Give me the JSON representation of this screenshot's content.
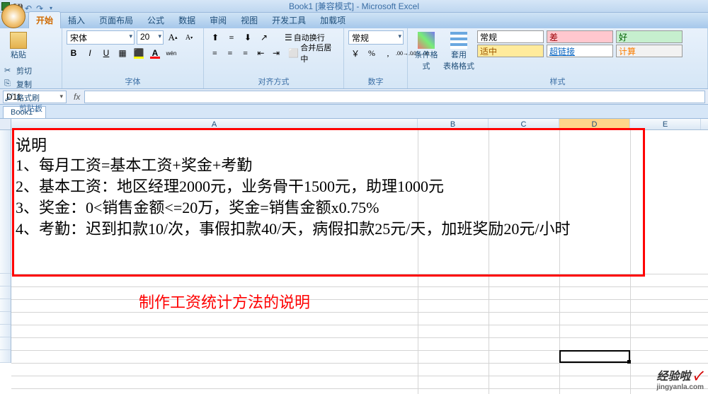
{
  "title": "Book1 [兼容模式] - Microsoft Excel",
  "tabs": [
    "开始",
    "插入",
    "页面布局",
    "公式",
    "数据",
    "审阅",
    "视图",
    "开发工具",
    "加载项"
  ],
  "clipboard": {
    "paste": "粘贴",
    "cut": "剪切",
    "copy": "复制",
    "painter": "格式刷",
    "title": "剪贴板"
  },
  "font": {
    "name": "宋体",
    "size": "20",
    "title": "字体"
  },
  "align": {
    "wrap": "自动换行",
    "merge": "合并后居中",
    "title": "对齐方式"
  },
  "number": {
    "format": "常规",
    "title": "数字"
  },
  "styles": {
    "cond": "条件格式",
    "tbl": "套用\n表格格式",
    "normal": "常规",
    "bad": "差",
    "good": "好",
    "mid": "适中",
    "link": "超链接",
    "calc": "计算",
    "title": "样式"
  },
  "nameBox": "D11",
  "workbook": "Book1 *",
  "columns": [
    "A",
    "B",
    "C",
    "D",
    "E"
  ],
  "content": {
    "title": "说明",
    "l1": "1、每月工资=基本工资+奖金+考勤",
    "l2": "2、基本工资：地区经理2000元，业务骨干1500元，助理1000元",
    "l3": "3、奖金：0<销售金额<=20万，奖金=销售金额x0.75%",
    "l4": "4、考勤：迟到扣款10/次，事假扣款40/天，病假扣款25元/天，加班奖励20元/小时"
  },
  "caption": "制作工资统计方法的说明",
  "watermark": {
    "brand": "经验啦",
    "check": "✓",
    "url": "jingyanla.com"
  }
}
